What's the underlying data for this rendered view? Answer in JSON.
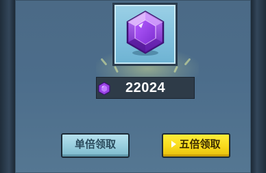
{
  "reward": {
    "item_icon": "purple-gem-icon",
    "count": "22024"
  },
  "buttons": {
    "single_label": "单倍领取",
    "five_label": "五倍领取",
    "five_icon": "play-icon"
  },
  "colors": {
    "panel": "#4c6d8b",
    "icon_box": "#7fbfdc",
    "gem": "#8a3dd6",
    "count_bar": "#2e3b48",
    "button_single": "#97cddd",
    "button_five": "#f8da1c"
  }
}
